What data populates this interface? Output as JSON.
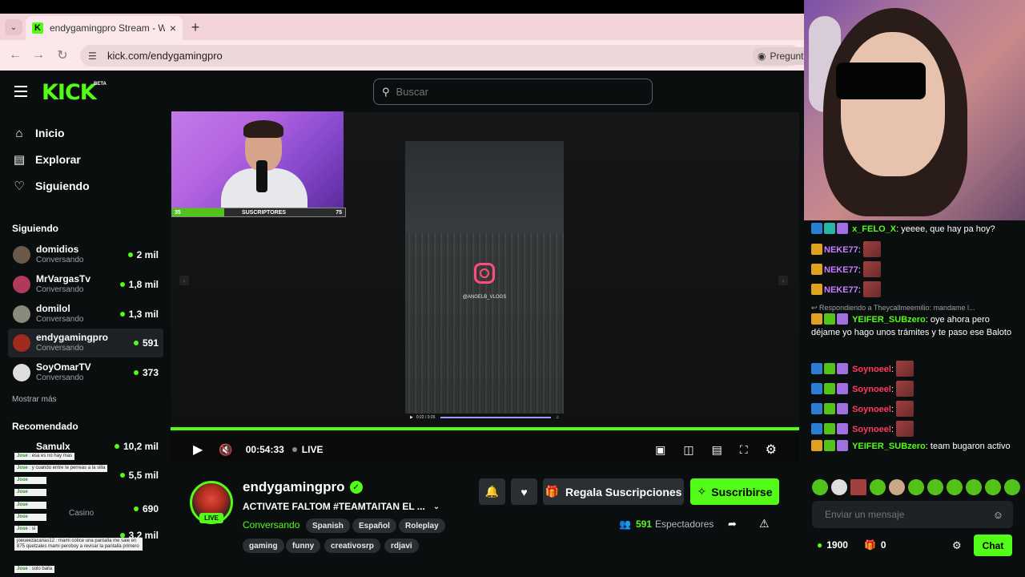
{
  "browser": {
    "tab_title": "endygamingpro Stream - Watc",
    "tab_icon": "K",
    "url": "kick.com/endygamingpro",
    "pregunta": "Pregunta"
  },
  "header": {
    "logo": "KICK",
    "beta": "BETA",
    "search_placeholder": "Buscar"
  },
  "nav": {
    "items": [
      {
        "label": "Inicio",
        "icon": "home-icon"
      },
      {
        "label": "Explorar",
        "icon": "browse-icon"
      },
      {
        "label": "Siguiendo",
        "icon": "heart-icon"
      }
    ]
  },
  "sidebar": {
    "following_title": "Siguiendo",
    "following": [
      {
        "name": "domidios",
        "sub": "Conversando",
        "count": "2 mil"
      },
      {
        "name": "MrVargasTv",
        "sub": "Conversando",
        "count": "1,8 mil"
      },
      {
        "name": "domilol",
        "sub": "Conversando",
        "count": "1,3 mil"
      },
      {
        "name": "endygamingpro",
        "sub": "Conversando",
        "count": "591"
      },
      {
        "name": "SoyOmarTV",
        "sub": "Conversando",
        "count": "373"
      }
    ],
    "show_more": "Mostrar más",
    "recommended_title": "Recomendado",
    "recommended": [
      {
        "name": "Samulx",
        "count": "10,2 mil"
      },
      {
        "name": "",
        "count": "5,5 mil"
      },
      {
        "name": "",
        "sub": "Casino",
        "count": "690"
      },
      {
        "name": "",
        "count": "3,2 mil"
      }
    ]
  },
  "overlay_chat": [
    "esa es no hay mas",
    "y cuando entre te perreas a la silla",
    "si",
    "joeueezacarias12 : mami cotice una pantalla me sale en 875 quetzales mami peroboy a revisar la pantalla primero",
    "solo baila"
  ],
  "video": {
    "sub_left": "35",
    "sub_label": "SUSCRIPTORES",
    "sub_right": "75",
    "ig_handle": "@ANGELB_VLOGS",
    "phone_time": "0:22 / 0:26",
    "time": "00:54:33",
    "live": "LIVE"
  },
  "channel": {
    "name": "endygamingpro",
    "live_badge": "LIVE",
    "title": "ACTIVATE FALTOM  #TEAMTAITAN EL ...",
    "category": "Conversando",
    "tags_row1": [
      "Spanish",
      "Español",
      "Roleplay"
    ],
    "tags_row2": [
      "gaming",
      "funny",
      "creativosrp",
      "rdjavi"
    ],
    "gift_label": "Regala Suscripciones",
    "subscribe_label": "Suscribirse",
    "viewers_count": "591",
    "viewers_label": "Espectadores"
  },
  "chat": {
    "messages": [
      {
        "user": "x_FELO_X",
        "color": "#53fc18",
        "text": "yeeee, que hay pa hoy?"
      },
      {
        "user": "NEKE77",
        "color": "#c77dff",
        "text": ""
      },
      {
        "user": "NEKE77",
        "color": "#c77dff",
        "text": ""
      },
      {
        "user": "NEKE77",
        "color": "#c77dff",
        "text": ""
      }
    ],
    "reply_to": "Respondiendo a Theycallmeemilio: mandame l...",
    "yeifer1_user": "YEIFER_SUBzero",
    "yeifer1_text": "oye ahora pero déjame yo hago unos trámites y te paso ese Baloto",
    "soyno": [
      {
        "user": "Soynoeel"
      },
      {
        "user": "Soynoeel"
      },
      {
        "user": "Soynoeel"
      },
      {
        "user": "Soynoeel"
      }
    ],
    "yeifer2_user": "YEIFER_SUBzero",
    "yeifer2_text": "team bugaron activo",
    "input_placeholder": "Enviar un mensaje",
    "points": "1900",
    "gifts": "0",
    "chat_button": "Chat"
  },
  "colors": {
    "accent": "#53fc18",
    "background": "#0b0e0f",
    "panel": "#2a2f33"
  }
}
